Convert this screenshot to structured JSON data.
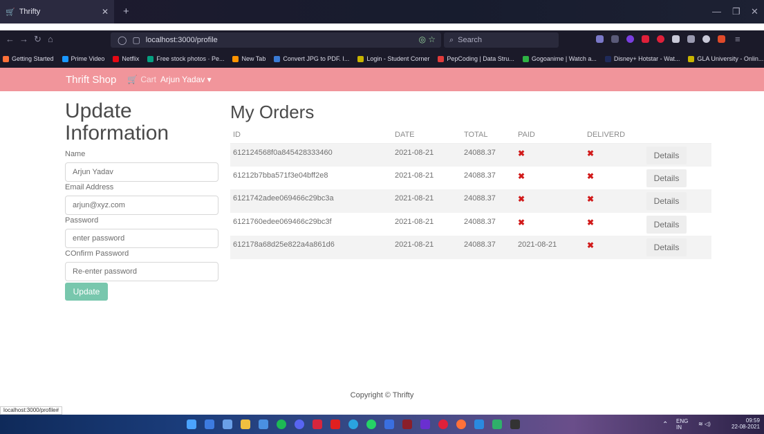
{
  "browser": {
    "tab_title": "Thrifty",
    "url": "localhost:3000/profile",
    "search_placeholder": "Search",
    "bookmarks": [
      {
        "label": "Getting Started",
        "color": "#ff7139"
      },
      {
        "label": "Prime Video",
        "color": "#1a98ff"
      },
      {
        "label": "Netflix",
        "color": "#e50914"
      },
      {
        "label": "Free stock photos · Pe...",
        "color": "#05a081"
      },
      {
        "label": "New Tab",
        "color": "#ff9400"
      },
      {
        "label": "Convert JPG to PDF. I...",
        "color": "#3a7bd5"
      },
      {
        "label": "Login - Student Corner",
        "color": "#c8b400"
      },
      {
        "label": "PepCoding | Data Stru...",
        "color": "#e23b3b"
      },
      {
        "label": "Gogoanime | Watch a...",
        "color": "#2fb344"
      },
      {
        "label": "Disney+ Hotstar - Wat...",
        "color": "#1f2a5a"
      },
      {
        "label": "GLA University - Onlin...",
        "color": "#c8b400"
      }
    ],
    "status_url": "localhost:3000/profile#"
  },
  "app": {
    "brand": "Thrift Shop",
    "cart_label": "Cart",
    "user_label": "Arjun Yadav ▾"
  },
  "profile_form": {
    "title": "Update Information",
    "name_label": "Name",
    "name_value": "Arjun Yadav",
    "email_label": "Email Address",
    "email_value": "arjun@xyz.com",
    "password_label": "Password",
    "password_placeholder": "enter password",
    "confirm_label": "COnfirm Password",
    "confirm_placeholder": "Re-enter password",
    "submit_label": "Update"
  },
  "orders": {
    "title": "My Orders",
    "columns": [
      "ID",
      "DATE",
      "TOTAL",
      "PAID",
      "DELIVERD",
      ""
    ],
    "details_label": "Details",
    "rows": [
      {
        "id": "612124568f0a845428333460",
        "date": "2021-08-21",
        "total": "24088.37",
        "paid": "✖",
        "delivered": "✖"
      },
      {
        "id": "61212b7bba571f3e04bff2e8",
        "date": "2021-08-21",
        "total": "24088.37",
        "paid": "✖",
        "delivered": "✖"
      },
      {
        "id": "6121742adee069466c29bc3a",
        "date": "2021-08-21",
        "total": "24088.37",
        "paid": "✖",
        "delivered": "✖"
      },
      {
        "id": "6121760edee069466c29bc3f",
        "date": "2021-08-21",
        "total": "24088.37",
        "paid": "✖",
        "delivered": "✖"
      },
      {
        "id": "612178a68d25e822a4a861d6",
        "date": "2021-08-21",
        "total": "24088.37",
        "paid": "2021-08-21",
        "delivered": "✖"
      }
    ]
  },
  "footer": {
    "copyright": "Copyright © Thrifty"
  },
  "taskbar": {
    "lang": "ENG",
    "region": "IN",
    "time": "09:59",
    "date": "22-08-2021"
  }
}
